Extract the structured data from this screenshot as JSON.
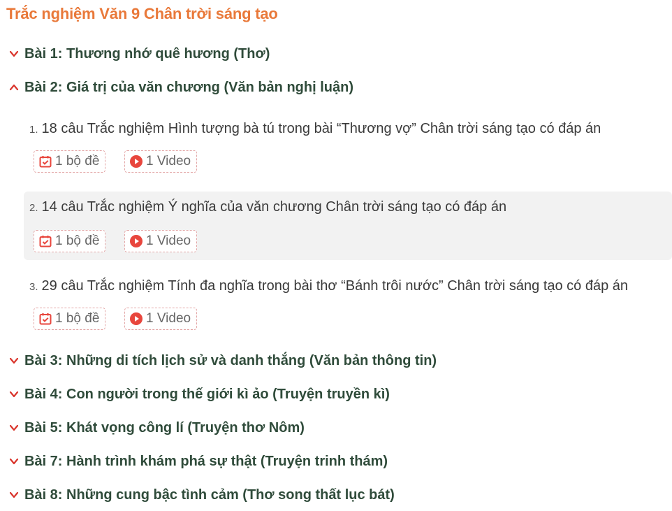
{
  "page": {
    "title": "Trắc nghiệm Văn 9 Chân trời sáng tạo"
  },
  "lessons": [
    {
      "label": "Bài 1: Thương nhớ quê hương (Thơ)",
      "expanded": false
    },
    {
      "label": "Bài 2: Giá trị của văn chương (Văn bản nghị luận)",
      "expanded": true
    },
    {
      "label": "Bài 3: Những di tích lịch sử và danh thắng (Văn bản thông tin)",
      "expanded": false
    },
    {
      "label": "Bài 4: Con người trong thế giới kì ảo (Truyện truyền kì)",
      "expanded": false
    },
    {
      "label": "Bài 5: Khát vọng công lí (Truyện thơ Nôm)",
      "expanded": false
    },
    {
      "label": "Bài 7: Hành trình khám phá sự thật (Truyện trinh thám)",
      "expanded": false
    },
    {
      "label": "Bài 8: Những cung bậc tình cảm (Thơ song thất lục bát)",
      "expanded": false
    }
  ],
  "sub_items": [
    {
      "number": "1.",
      "title": "18 câu Trắc nghiệm Hình tượng bà tú trong bài “Thương vợ” Chân trời sáng tạo có đáp án",
      "exam_label": "1 bộ đề",
      "video_label": "1 Video"
    },
    {
      "number": "2.",
      "title": "14 câu Trắc nghiệm Ý nghĩa của văn chương Chân trời sáng tạo có đáp án",
      "exam_label": "1 bộ đề",
      "video_label": "1 Video"
    },
    {
      "number": "3.",
      "title": "29 câu Trắc nghiệm Tính đa nghĩa trong bài thơ “Bánh trôi nước” Chân trời sáng tạo có đáp án",
      "exam_label": "1 bộ đề",
      "video_label": "1 Video"
    }
  ],
  "icons": {
    "chevron_down": "chevron-down-icon",
    "chevron_up": "chevron-up-icon",
    "exam": "calendar-check-icon",
    "video": "play-circle-icon"
  },
  "colors": {
    "title": "#e9793a",
    "lesson_text": "#2f4b3a",
    "chevron": "#d9342b",
    "chip_border": "#e3a6a6",
    "icon_red": "#e8463d",
    "active_row_bg": "#f2f2f2"
  }
}
